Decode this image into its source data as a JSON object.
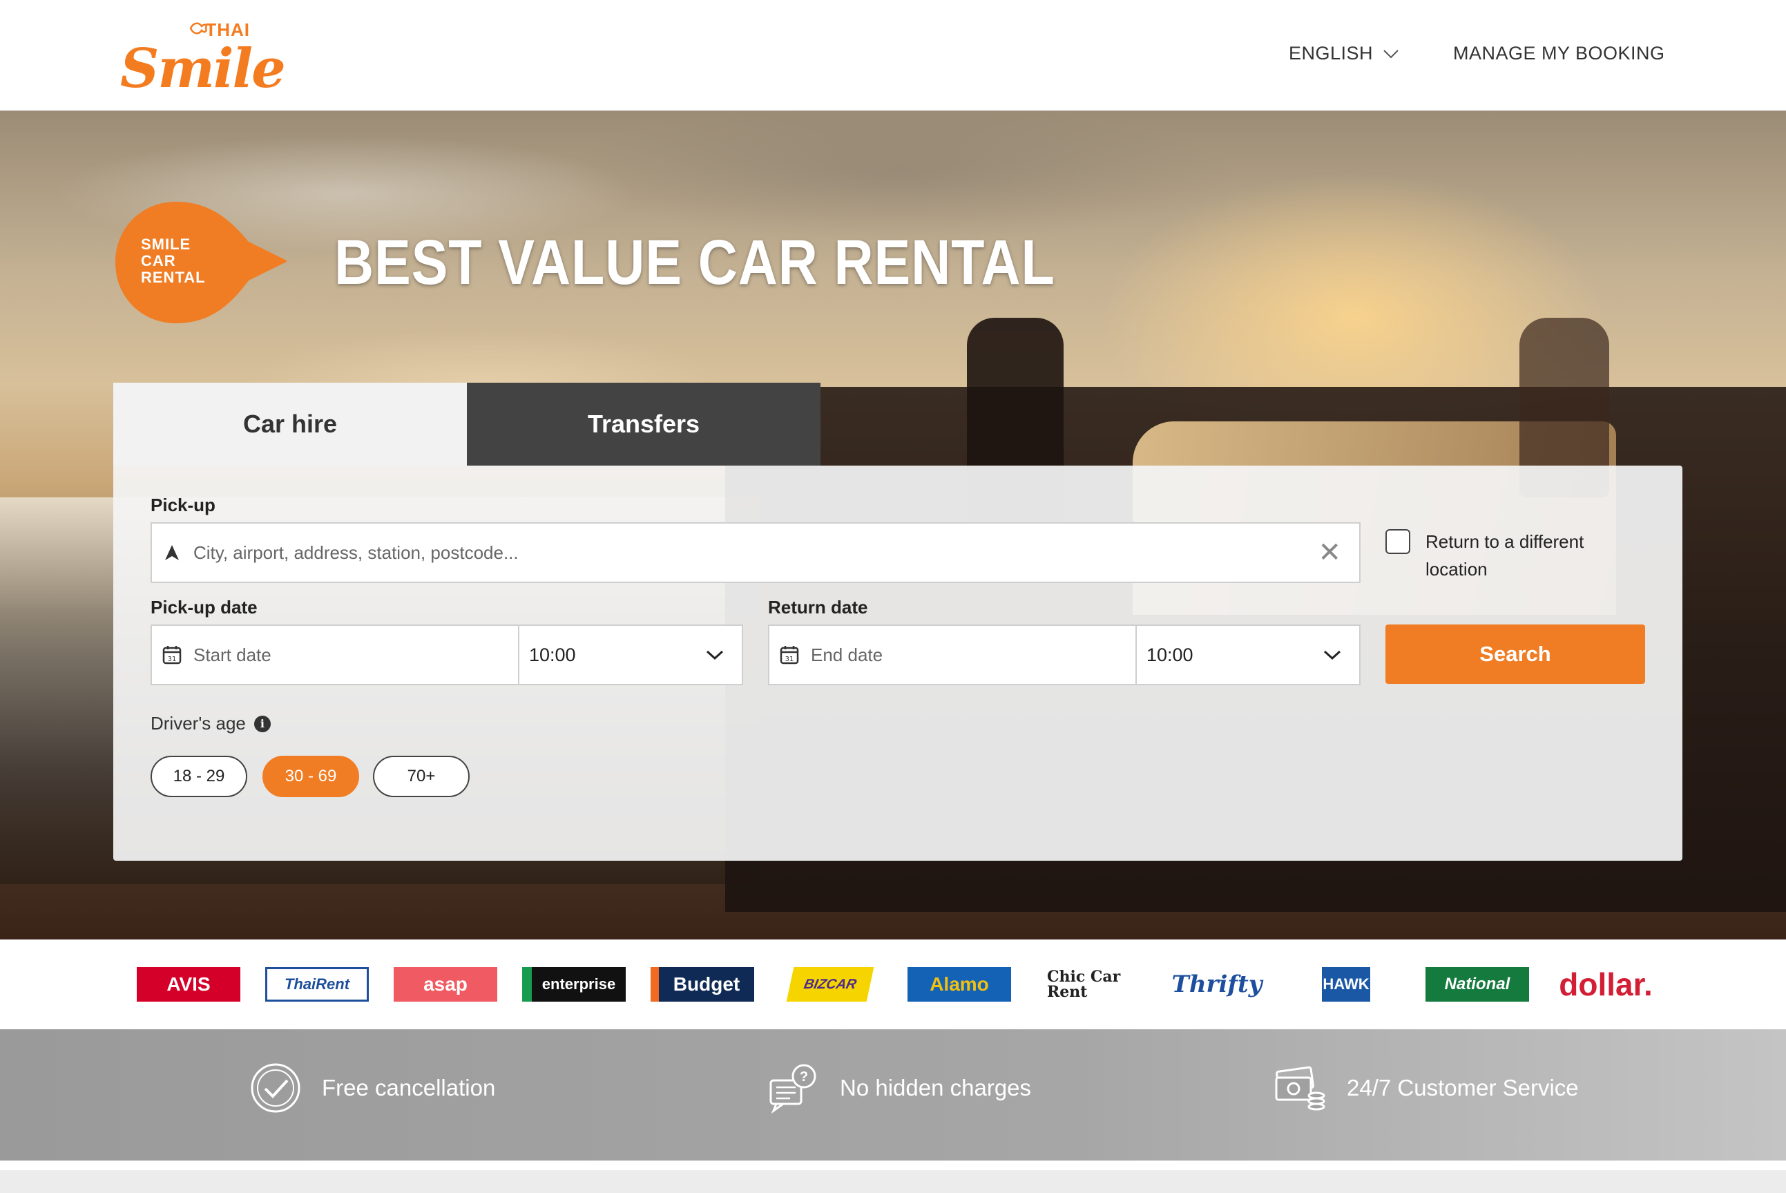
{
  "header": {
    "logo_small": "THAI",
    "logo_main": "Smile",
    "language": "ENGLISH",
    "manage_booking": "MANAGE MY BOOKING"
  },
  "hero": {
    "badge_lines": [
      "SMILE",
      "CAR",
      "RENTAL"
    ],
    "title": "BEST VALUE CAR RENTAL"
  },
  "tabs": [
    {
      "label": "Car hire",
      "active": true
    },
    {
      "label": "Transfers",
      "active": false
    }
  ],
  "form": {
    "pickup_label": "Pick-up",
    "pickup_placeholder": "City, airport, address, station, postcode...",
    "return_different_label": "Return to a different location",
    "pickup_date_label": "Pick-up date",
    "pickup_date_placeholder": "Start date",
    "pickup_time": "10:00",
    "return_date_label": "Return date",
    "return_date_placeholder": "End date",
    "return_time": "10:00",
    "search_label": "Search",
    "driver_age_label": "Driver's age",
    "calendar_day": "31",
    "age_options": [
      "18 - 29",
      "30 - 69",
      "70+"
    ],
    "age_selected": "30 - 69"
  },
  "brands": [
    "AVIS",
    "ThaiRent",
    "asap",
    "enterprise",
    "Budget",
    "BIZCAR",
    "Alamo",
    "Chic Car Rent",
    "Thrifty",
    "HAWK",
    "National",
    "dollar."
  ],
  "features": [
    {
      "icon": "check-circle-icon",
      "label": "Free cancellation"
    },
    {
      "icon": "question-chat-icon",
      "label": "No hidden charges"
    },
    {
      "icon": "money-stack-icon",
      "label": "24/7 Customer Service"
    }
  ],
  "colors": {
    "accent": "#f07d24",
    "brand_orange": "#f47c20",
    "dark_tab": "#434343"
  }
}
